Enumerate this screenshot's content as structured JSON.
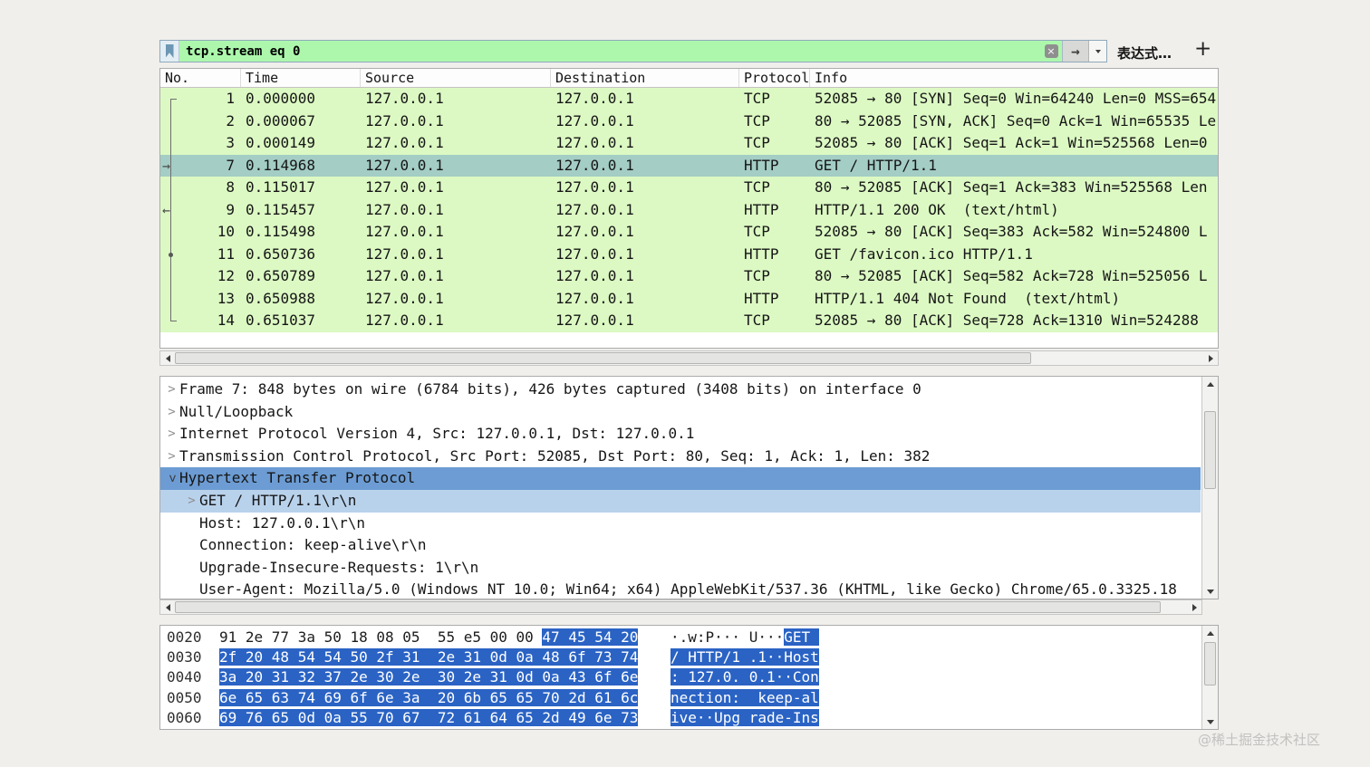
{
  "filter_bar": {
    "value": "tcp.stream eq 0",
    "expression_label": "表达式…",
    "add_button": "+"
  },
  "packet_list": {
    "columns": [
      "No.",
      "Time",
      "Source",
      "Destination",
      "Protocol",
      "Info"
    ],
    "rows": [
      {
        "no": "1",
        "time": "0.000000",
        "source": "127.0.0.1",
        "destination": "127.0.0.1",
        "protocol": "TCP",
        "info": "52085 → 80 [SYN] Seq=0 Win=64240 Len=0 MSS=654",
        "selected": false,
        "mark": "bracket-start"
      },
      {
        "no": "2",
        "time": "0.000067",
        "source": "127.0.0.1",
        "destination": "127.0.0.1",
        "protocol": "TCP",
        "info": "80 → 52085 [SYN, ACK] Seq=0 Ack=1 Win=65535 Le",
        "selected": false,
        "mark": "line"
      },
      {
        "no": "3",
        "time": "0.000149",
        "source": "127.0.0.1",
        "destination": "127.0.0.1",
        "protocol": "TCP",
        "info": "52085 → 80 [ACK] Seq=1 Ack=1 Win=525568 Len=0",
        "selected": false,
        "mark": "line"
      },
      {
        "no": "7",
        "time": "0.114968",
        "source": "127.0.0.1",
        "destination": "127.0.0.1",
        "protocol": "HTTP",
        "info": "GET / HTTP/1.1",
        "selected": true,
        "mark": "arrow-right"
      },
      {
        "no": "8",
        "time": "0.115017",
        "source": "127.0.0.1",
        "destination": "127.0.0.1",
        "protocol": "TCP",
        "info": "80 → 52085 [ACK] Seq=1 Ack=383 Win=525568 Len",
        "selected": false,
        "mark": "line"
      },
      {
        "no": "9",
        "time": "0.115457",
        "source": "127.0.0.1",
        "destination": "127.0.0.1",
        "protocol": "HTTP",
        "info": "HTTP/1.1 200 OK  (text/html)",
        "selected": false,
        "mark": "arrow-left"
      },
      {
        "no": "10",
        "time": "0.115498",
        "source": "127.0.0.1",
        "destination": "127.0.0.1",
        "protocol": "TCP",
        "info": "52085 → 80 [ACK] Seq=383 Ack=582 Win=524800 L",
        "selected": false,
        "mark": "line"
      },
      {
        "no": "11",
        "time": "0.650736",
        "source": "127.0.0.1",
        "destination": "127.0.0.1",
        "protocol": "HTTP",
        "info": "GET /favicon.ico HTTP/1.1",
        "selected": false,
        "mark": "dot"
      },
      {
        "no": "12",
        "time": "0.650789",
        "source": "127.0.0.1",
        "destination": "127.0.0.1",
        "protocol": "TCP",
        "info": "80 → 52085 [ACK] Seq=582 Ack=728 Win=525056 L",
        "selected": false,
        "mark": "line"
      },
      {
        "no": "13",
        "time": "0.650988",
        "source": "127.0.0.1",
        "destination": "127.0.0.1",
        "protocol": "HTTP",
        "info": "HTTP/1.1 404 Not Found  (text/html)",
        "selected": false,
        "mark": "line"
      },
      {
        "no": "14",
        "time": "0.651037",
        "source": "127.0.0.1",
        "destination": "127.0.0.1",
        "protocol": "TCP",
        "info": "52085 → 80 [ACK] Seq=728 Ack=1310 Win=524288",
        "selected": false,
        "mark": "bracket-end"
      }
    ]
  },
  "details": {
    "lines": [
      {
        "indent": 0,
        "expander": "collapsed",
        "highlight": "none",
        "text": "Frame 7: 848 bytes on wire (6784 bits), 426 bytes captured (3408 bits) on interface 0"
      },
      {
        "indent": 0,
        "expander": "collapsed",
        "highlight": "none",
        "text": "Null/Loopback"
      },
      {
        "indent": 0,
        "expander": "collapsed",
        "highlight": "none",
        "text": "Internet Protocol Version 4, Src: 127.0.0.1, Dst: 127.0.0.1"
      },
      {
        "indent": 0,
        "expander": "collapsed",
        "highlight": "none",
        "text": "Transmission Control Protocol, Src Port: 52085, Dst Port: 80, Seq: 1, Ack: 1, Len: 382"
      },
      {
        "indent": 0,
        "expander": "expanded",
        "highlight": "primary",
        "text": "Hypertext Transfer Protocol"
      },
      {
        "indent": 1,
        "expander": "collapsed",
        "highlight": "secondary",
        "text": "GET / HTTP/1.1\\r\\n"
      },
      {
        "indent": 1,
        "expander": "none",
        "highlight": "none",
        "text": "Host: 127.0.0.1\\r\\n"
      },
      {
        "indent": 1,
        "expander": "none",
        "highlight": "none",
        "text": "Connection: keep-alive\\r\\n"
      },
      {
        "indent": 1,
        "expander": "none",
        "highlight": "none",
        "text": "Upgrade-Insecure-Requests: 1\\r\\n"
      },
      {
        "indent": 1,
        "expander": "none",
        "highlight": "none",
        "text": "User-Agent: Mozilla/5.0 (Windows NT 10.0; Win64; x64) AppleWebKit/537.36 (KHTML, like Gecko) Chrome/65.0.3325.18"
      }
    ]
  },
  "hex_view": {
    "rows": [
      {
        "offset": "0020",
        "hex": [
          {
            "t": "91 2e 77 3a 50 18 08 05  55 e5 00 00 ",
            "s": false
          },
          {
            "t": "47 45 54 20",
            "s": true
          }
        ],
        "ascii": [
          {
            "t": "·.w:P··· U···",
            "s": false
          },
          {
            "t": "GET ",
            "s": true
          }
        ]
      },
      {
        "offset": "0030",
        "hex": [
          {
            "t": "2f 20 48 54 54 50 2f 31  2e 31 0d 0a 48 6f 73 74",
            "s": true
          }
        ],
        "ascii": [
          {
            "t": "/ HTTP/1 .1··Host",
            "s": true
          }
        ]
      },
      {
        "offset": "0040",
        "hex": [
          {
            "t": "3a 20 31 32 37 2e 30 2e  30 2e 31 0d 0a 43 6f 6e",
            "s": true
          }
        ],
        "ascii": [
          {
            "t": ": 127.0. 0.1··Con",
            "s": true
          }
        ]
      },
      {
        "offset": "0050",
        "hex": [
          {
            "t": "6e 65 63 74 69 6f 6e 3a  20 6b 65 65 70 2d 61 6c",
            "s": true
          }
        ],
        "ascii": [
          {
            "t": "nection:  keep-al",
            "s": true
          }
        ]
      },
      {
        "offset": "0060",
        "hex": [
          {
            "t": "69 76 65 0d 0a 55 70 67  72 61 64 65 2d 49 6e 73",
            "s": true
          }
        ],
        "ascii": [
          {
            "t": "ive··Upg rade-Ins",
            "s": true
          }
        ]
      }
    ]
  },
  "watermark": "@稀土掘金技术社区"
}
